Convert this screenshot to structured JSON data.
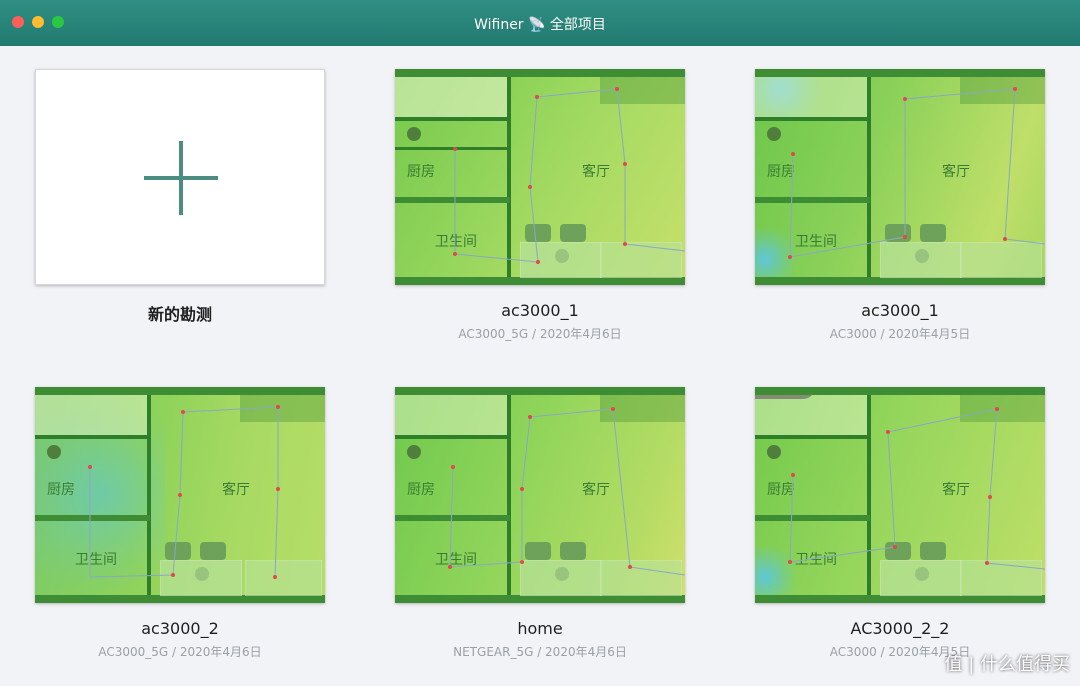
{
  "window": {
    "title": "Wifiner 📡 全部项目"
  },
  "projects": [
    {
      "name": "新的勘测",
      "subtitle": ""
    },
    {
      "name": "ac3000_1",
      "subtitle": "AC3000_5G / 2020年4月6日"
    },
    {
      "name": "ac3000_1",
      "subtitle": "AC3000 / 2020年4月5日"
    },
    {
      "name": "ac3000_2",
      "subtitle": "AC3000_5G / 2020年4月6日"
    },
    {
      "name": "home",
      "subtitle": "NETGEAR_5G / 2020年4月6日"
    },
    {
      "name": "AC3000_2_2",
      "subtitle": "AC3000 / 2020年4月5日"
    }
  ],
  "room_labels": {
    "kitchen": "厨房",
    "living": "客厅",
    "bath": "卫生间"
  },
  "watermark": "值 | 什么值得买",
  "colors": {
    "titlebar": "#2a857a",
    "accent": "#4b8d80",
    "heat_green": "#9ad55c"
  },
  "icons": {
    "new_survey": "plus-icon",
    "satellite": "satellite-icon"
  }
}
